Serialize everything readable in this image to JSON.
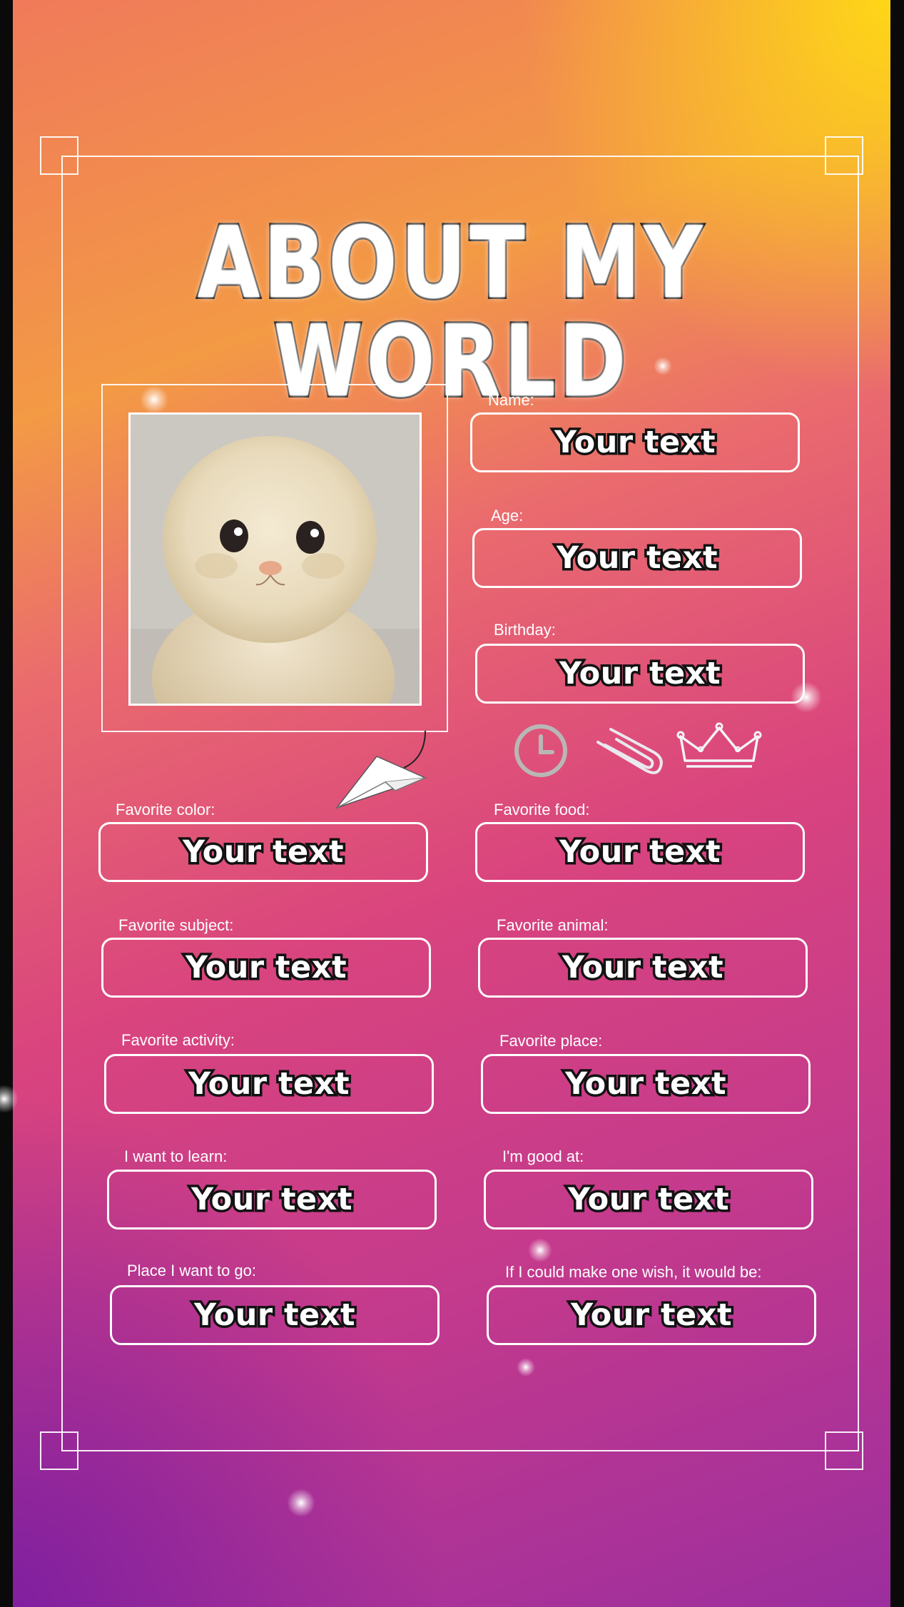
{
  "title": "ABOUT MY WORLD",
  "photo": {
    "alt": "cream-colored kitten"
  },
  "fields": {
    "name": {
      "label": "Name:",
      "value": "Your text"
    },
    "age": {
      "label": "Age:",
      "value": "Your text"
    },
    "birthday": {
      "label": "Birthday:",
      "value": "Your text"
    },
    "favorite_color": {
      "label": "Favorite color:",
      "value": "Your text"
    },
    "favorite_food": {
      "label": "Favorite food:",
      "value": "Your text"
    },
    "favorite_subject": {
      "label": "Favorite subject:",
      "value": "Your text"
    },
    "favorite_animal": {
      "label": "Favorite animal:",
      "value": "Your text"
    },
    "favorite_activity": {
      "label": "Favorite activity:",
      "value": "Your text"
    },
    "favorite_place": {
      "label": "Favorite place:",
      "value": "Your text"
    },
    "want_to_learn": {
      "label": "I want to learn:",
      "value": "Your text"
    },
    "good_at": {
      "label": "I'm good at:",
      "value": "Your text"
    },
    "place_to_go": {
      "label": "Place I want to go:",
      "value": "Your text"
    },
    "one_wish": {
      "label": "If I could make one wish, it would be:",
      "value": "Your text"
    }
  },
  "icons": [
    "clock-icon",
    "paperclip-icon",
    "crown-icon",
    "paper-plane-icon"
  ],
  "colors": {
    "top_right": "#ffd814",
    "middle": "#d9447e",
    "bottom_left": "#7d1ea0",
    "frame": "#ffffff"
  }
}
